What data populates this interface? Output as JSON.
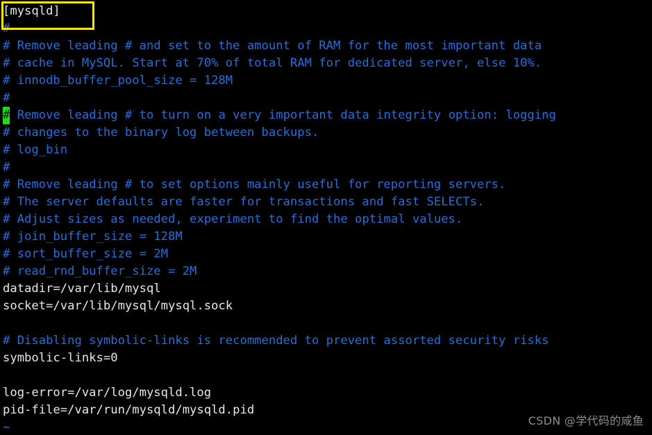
{
  "editor": {
    "app": "vim",
    "file_type": "mysql-config",
    "colors": {
      "background": "#000000",
      "comment": "#1f6fe0",
      "value_text": "#e8e8e8",
      "cursor_block": "#19e019",
      "cursor_glyph": "#0b1a0b",
      "highlight_box": "#ffe800",
      "watermark": "#8e8e8e",
      "tilde": "#1f6fe0"
    },
    "cursor": {
      "line_index": 6,
      "column_index": 0,
      "character": "#"
    },
    "lines": [
      {
        "text": "[mysqld]",
        "style": "value"
      },
      {
        "text": "#",
        "style": "comment"
      },
      {
        "text": "# Remove leading # and set to the amount of RAM for the most important data",
        "style": "comment"
      },
      {
        "text": "# cache in MySQL. Start at 70% of total RAM for dedicated server, else 10%.",
        "style": "comment"
      },
      {
        "text": "# innodb_buffer_pool_size = 128M",
        "style": "comment"
      },
      {
        "text": "#",
        "style": "comment"
      },
      {
        "text": "# Remove leading # to turn on a very important data integrity option: logging",
        "style": "comment",
        "has_cursor": true
      },
      {
        "text": "# changes to the binary log between backups.",
        "style": "comment"
      },
      {
        "text": "# log_bin",
        "style": "comment"
      },
      {
        "text": "#",
        "style": "comment"
      },
      {
        "text": "# Remove leading # to set options mainly useful for reporting servers.",
        "style": "comment"
      },
      {
        "text": "# The server defaults are faster for transactions and fast SELECTs.",
        "style": "comment"
      },
      {
        "text": "# Adjust sizes as needed, experiment to find the optimal values.",
        "style": "comment"
      },
      {
        "text": "# join_buffer_size = 128M",
        "style": "comment"
      },
      {
        "text": "# sort_buffer_size = 2M",
        "style": "comment"
      },
      {
        "text": "# read_rnd_buffer_size = 2M",
        "style": "comment"
      },
      {
        "text": "datadir=/var/lib/mysql",
        "style": "value"
      },
      {
        "text": "socket=/var/lib/mysql/mysql.sock",
        "style": "value"
      },
      {
        "text": "",
        "style": "blank"
      },
      {
        "text": "# Disabling symbolic-links is recommended to prevent assorted security risks",
        "style": "comment"
      },
      {
        "text": "symbolic-links=0",
        "style": "value"
      },
      {
        "text": "",
        "style": "blank"
      },
      {
        "text": "log-error=/var/log/mysqld.log",
        "style": "value"
      },
      {
        "text": "pid-file=/var/run/mysqld/mysqld.pid",
        "style": "value"
      },
      {
        "text": "~",
        "style": "tilde"
      }
    ]
  },
  "annotation": {
    "highlight_box_label": "section-header-highlight"
  },
  "watermark": {
    "text": "CSDN @学代码的咸鱼"
  }
}
